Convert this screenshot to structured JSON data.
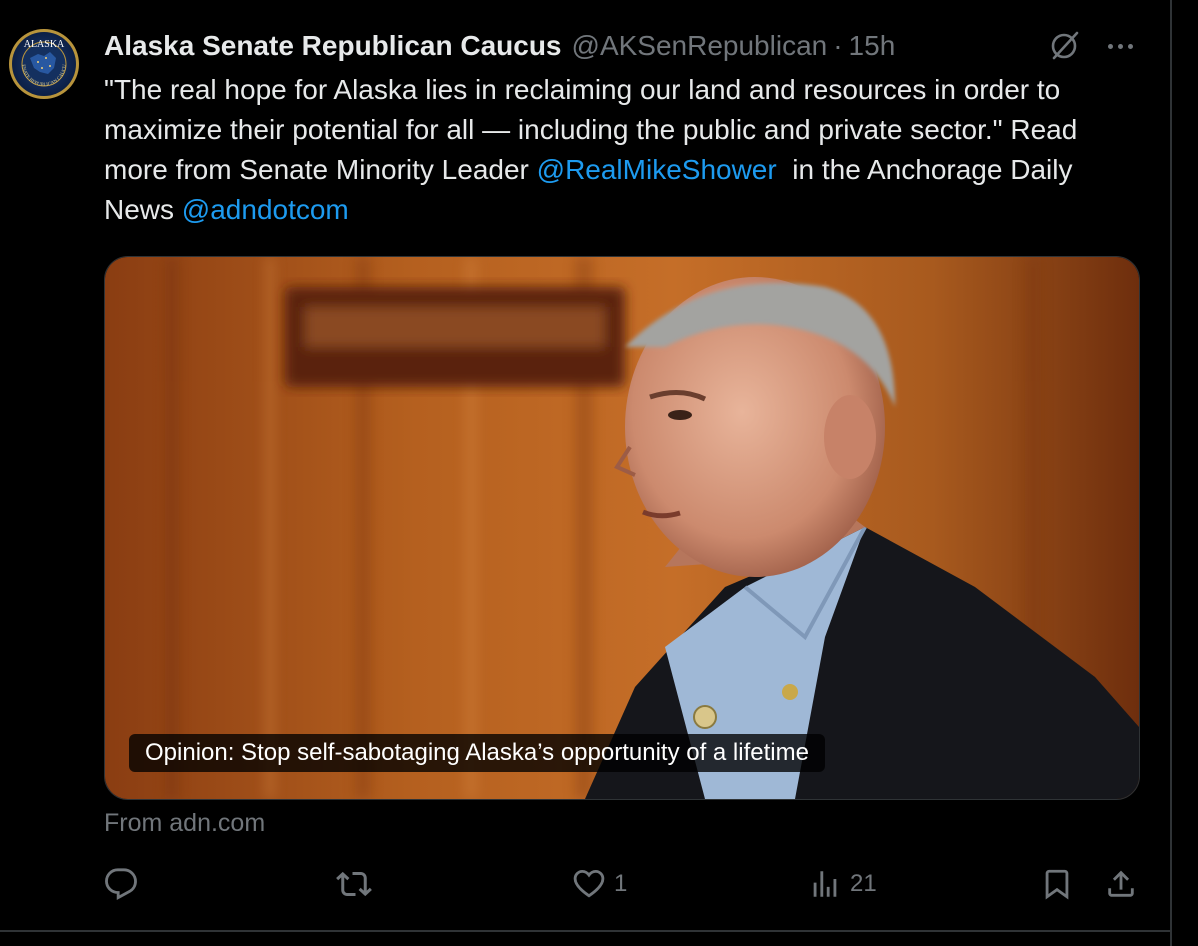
{
  "tweet": {
    "author_name": "Alaska Senate Republican Caucus",
    "handle": "@AKSenRepublican",
    "separator": "·",
    "time": "15h",
    "avatar": {
      "top_text": "ALASKA",
      "ring_text": "SENATE REPUBLICAN CAUCUS"
    },
    "body": {
      "text_1": "\"The real hope for Alaska lies in reclaiming our land and resources in order to maximize their potential for all — including the public and private sector.\" Read more from Senate Minority Leader ",
      "mention_1": "@RealMikeShower",
      "text_2": "  in the Anchorage Daily News ",
      "mention_2": "@adndotcom"
    },
    "card": {
      "caption": "Opinion: Stop self-sabotaging Alaska’s opportunity of a lifetime"
    },
    "source": "From adn.com",
    "actions": {
      "reply_count": "",
      "retweet_count": "",
      "like_count": "1",
      "views_count": "21"
    },
    "icons": [
      "grok-icon",
      "more-icon",
      "reply-icon",
      "retweet-icon",
      "like-icon",
      "views-icon",
      "bookmark-icon",
      "share-icon"
    ],
    "colors": {
      "background": "#000000",
      "text": "#e7e9ea",
      "muted": "#71767b",
      "link": "#1d9bf0"
    }
  }
}
